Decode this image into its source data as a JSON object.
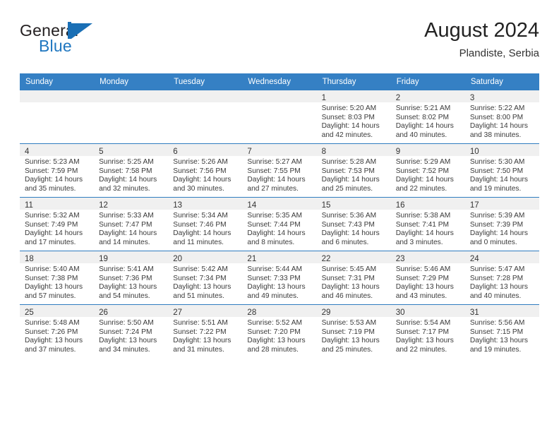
{
  "brand": {
    "name_top": "General",
    "name_bottom": "Blue",
    "accent_color": "#2077c0"
  },
  "header": {
    "title": "August 2024",
    "subtitle": "Plandiste, Serbia"
  },
  "theme": {
    "header_row_bg": "#3580c4",
    "row_border": "#2f7cc0",
    "daynum_band_bg": "#f0f0f0"
  },
  "weekday_headers": [
    "Sunday",
    "Monday",
    "Tuesday",
    "Wednesday",
    "Thursday",
    "Friday",
    "Saturday"
  ],
  "weeks": [
    [
      {
        "day": "",
        "sunrise": "",
        "sunset": "",
        "daylight1": "",
        "daylight2": ""
      },
      {
        "day": "",
        "sunrise": "",
        "sunset": "",
        "daylight1": "",
        "daylight2": ""
      },
      {
        "day": "",
        "sunrise": "",
        "sunset": "",
        "daylight1": "",
        "daylight2": ""
      },
      {
        "day": "",
        "sunrise": "",
        "sunset": "",
        "daylight1": "",
        "daylight2": ""
      },
      {
        "day": "1",
        "sunrise": "Sunrise: 5:20 AM",
        "sunset": "Sunset: 8:03 PM",
        "daylight1": "Daylight: 14 hours",
        "daylight2": "and 42 minutes."
      },
      {
        "day": "2",
        "sunrise": "Sunrise: 5:21 AM",
        "sunset": "Sunset: 8:02 PM",
        "daylight1": "Daylight: 14 hours",
        "daylight2": "and 40 minutes."
      },
      {
        "day": "3",
        "sunrise": "Sunrise: 5:22 AM",
        "sunset": "Sunset: 8:00 PM",
        "daylight1": "Daylight: 14 hours",
        "daylight2": "and 38 minutes."
      }
    ],
    [
      {
        "day": "4",
        "sunrise": "Sunrise: 5:23 AM",
        "sunset": "Sunset: 7:59 PM",
        "daylight1": "Daylight: 14 hours",
        "daylight2": "and 35 minutes."
      },
      {
        "day": "5",
        "sunrise": "Sunrise: 5:25 AM",
        "sunset": "Sunset: 7:58 PM",
        "daylight1": "Daylight: 14 hours",
        "daylight2": "and 32 minutes."
      },
      {
        "day": "6",
        "sunrise": "Sunrise: 5:26 AM",
        "sunset": "Sunset: 7:56 PM",
        "daylight1": "Daylight: 14 hours",
        "daylight2": "and 30 minutes."
      },
      {
        "day": "7",
        "sunrise": "Sunrise: 5:27 AM",
        "sunset": "Sunset: 7:55 PM",
        "daylight1": "Daylight: 14 hours",
        "daylight2": "and 27 minutes."
      },
      {
        "day": "8",
        "sunrise": "Sunrise: 5:28 AM",
        "sunset": "Sunset: 7:53 PM",
        "daylight1": "Daylight: 14 hours",
        "daylight2": "and 25 minutes."
      },
      {
        "day": "9",
        "sunrise": "Sunrise: 5:29 AM",
        "sunset": "Sunset: 7:52 PM",
        "daylight1": "Daylight: 14 hours",
        "daylight2": "and 22 minutes."
      },
      {
        "day": "10",
        "sunrise": "Sunrise: 5:30 AM",
        "sunset": "Sunset: 7:50 PM",
        "daylight1": "Daylight: 14 hours",
        "daylight2": "and 19 minutes."
      }
    ],
    [
      {
        "day": "11",
        "sunrise": "Sunrise: 5:32 AM",
        "sunset": "Sunset: 7:49 PM",
        "daylight1": "Daylight: 14 hours",
        "daylight2": "and 17 minutes."
      },
      {
        "day": "12",
        "sunrise": "Sunrise: 5:33 AM",
        "sunset": "Sunset: 7:47 PM",
        "daylight1": "Daylight: 14 hours",
        "daylight2": "and 14 minutes."
      },
      {
        "day": "13",
        "sunrise": "Sunrise: 5:34 AM",
        "sunset": "Sunset: 7:46 PM",
        "daylight1": "Daylight: 14 hours",
        "daylight2": "and 11 minutes."
      },
      {
        "day": "14",
        "sunrise": "Sunrise: 5:35 AM",
        "sunset": "Sunset: 7:44 PM",
        "daylight1": "Daylight: 14 hours",
        "daylight2": "and 8 minutes."
      },
      {
        "day": "15",
        "sunrise": "Sunrise: 5:36 AM",
        "sunset": "Sunset: 7:43 PM",
        "daylight1": "Daylight: 14 hours",
        "daylight2": "and 6 minutes."
      },
      {
        "day": "16",
        "sunrise": "Sunrise: 5:38 AM",
        "sunset": "Sunset: 7:41 PM",
        "daylight1": "Daylight: 14 hours",
        "daylight2": "and 3 minutes."
      },
      {
        "day": "17",
        "sunrise": "Sunrise: 5:39 AM",
        "sunset": "Sunset: 7:39 PM",
        "daylight1": "Daylight: 14 hours",
        "daylight2": "and 0 minutes."
      }
    ],
    [
      {
        "day": "18",
        "sunrise": "Sunrise: 5:40 AM",
        "sunset": "Sunset: 7:38 PM",
        "daylight1": "Daylight: 13 hours",
        "daylight2": "and 57 minutes."
      },
      {
        "day": "19",
        "sunrise": "Sunrise: 5:41 AM",
        "sunset": "Sunset: 7:36 PM",
        "daylight1": "Daylight: 13 hours",
        "daylight2": "and 54 minutes."
      },
      {
        "day": "20",
        "sunrise": "Sunrise: 5:42 AM",
        "sunset": "Sunset: 7:34 PM",
        "daylight1": "Daylight: 13 hours",
        "daylight2": "and 51 minutes."
      },
      {
        "day": "21",
        "sunrise": "Sunrise: 5:44 AM",
        "sunset": "Sunset: 7:33 PM",
        "daylight1": "Daylight: 13 hours",
        "daylight2": "and 49 minutes."
      },
      {
        "day": "22",
        "sunrise": "Sunrise: 5:45 AM",
        "sunset": "Sunset: 7:31 PM",
        "daylight1": "Daylight: 13 hours",
        "daylight2": "and 46 minutes."
      },
      {
        "day": "23",
        "sunrise": "Sunrise: 5:46 AM",
        "sunset": "Sunset: 7:29 PM",
        "daylight1": "Daylight: 13 hours",
        "daylight2": "and 43 minutes."
      },
      {
        "day": "24",
        "sunrise": "Sunrise: 5:47 AM",
        "sunset": "Sunset: 7:28 PM",
        "daylight1": "Daylight: 13 hours",
        "daylight2": "and 40 minutes."
      }
    ],
    [
      {
        "day": "25",
        "sunrise": "Sunrise: 5:48 AM",
        "sunset": "Sunset: 7:26 PM",
        "daylight1": "Daylight: 13 hours",
        "daylight2": "and 37 minutes."
      },
      {
        "day": "26",
        "sunrise": "Sunrise: 5:50 AM",
        "sunset": "Sunset: 7:24 PM",
        "daylight1": "Daylight: 13 hours",
        "daylight2": "and 34 minutes."
      },
      {
        "day": "27",
        "sunrise": "Sunrise: 5:51 AM",
        "sunset": "Sunset: 7:22 PM",
        "daylight1": "Daylight: 13 hours",
        "daylight2": "and 31 minutes."
      },
      {
        "day": "28",
        "sunrise": "Sunrise: 5:52 AM",
        "sunset": "Sunset: 7:20 PM",
        "daylight1": "Daylight: 13 hours",
        "daylight2": "and 28 minutes."
      },
      {
        "day": "29",
        "sunrise": "Sunrise: 5:53 AM",
        "sunset": "Sunset: 7:19 PM",
        "daylight1": "Daylight: 13 hours",
        "daylight2": "and 25 minutes."
      },
      {
        "day": "30",
        "sunrise": "Sunrise: 5:54 AM",
        "sunset": "Sunset: 7:17 PM",
        "daylight1": "Daylight: 13 hours",
        "daylight2": "and 22 minutes."
      },
      {
        "day": "31",
        "sunrise": "Sunrise: 5:56 AM",
        "sunset": "Sunset: 7:15 PM",
        "daylight1": "Daylight: 13 hours",
        "daylight2": "and 19 minutes."
      }
    ]
  ]
}
